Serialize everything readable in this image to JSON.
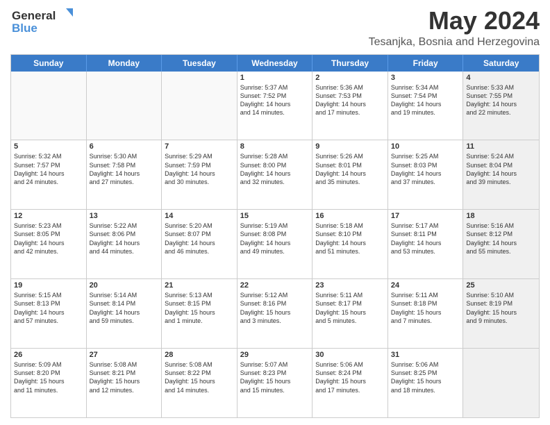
{
  "header": {
    "logo_line1": "General",
    "logo_line2": "Blue",
    "month_year": "May 2024",
    "location": "Tesanjka, Bosnia and Herzegovina"
  },
  "days_of_week": [
    "Sunday",
    "Monday",
    "Tuesday",
    "Wednesday",
    "Thursday",
    "Friday",
    "Saturday"
  ],
  "weeks": [
    [
      {
        "day": "",
        "info": "",
        "empty": true
      },
      {
        "day": "",
        "info": "",
        "empty": true
      },
      {
        "day": "",
        "info": "",
        "empty": true
      },
      {
        "day": "1",
        "info": "Sunrise: 5:37 AM\nSunset: 7:52 PM\nDaylight: 14 hours\nand 14 minutes.",
        "empty": false
      },
      {
        "day": "2",
        "info": "Sunrise: 5:36 AM\nSunset: 7:53 PM\nDaylight: 14 hours\nand 17 minutes.",
        "empty": false
      },
      {
        "day": "3",
        "info": "Sunrise: 5:34 AM\nSunset: 7:54 PM\nDaylight: 14 hours\nand 19 minutes.",
        "empty": false
      },
      {
        "day": "4",
        "info": "Sunrise: 5:33 AM\nSunset: 7:55 PM\nDaylight: 14 hours\nand 22 minutes.",
        "empty": false,
        "shaded": true
      }
    ],
    [
      {
        "day": "5",
        "info": "Sunrise: 5:32 AM\nSunset: 7:57 PM\nDaylight: 14 hours\nand 24 minutes.",
        "empty": false
      },
      {
        "day": "6",
        "info": "Sunrise: 5:30 AM\nSunset: 7:58 PM\nDaylight: 14 hours\nand 27 minutes.",
        "empty": false
      },
      {
        "day": "7",
        "info": "Sunrise: 5:29 AM\nSunset: 7:59 PM\nDaylight: 14 hours\nand 30 minutes.",
        "empty": false
      },
      {
        "day": "8",
        "info": "Sunrise: 5:28 AM\nSunset: 8:00 PM\nDaylight: 14 hours\nand 32 minutes.",
        "empty": false
      },
      {
        "day": "9",
        "info": "Sunrise: 5:26 AM\nSunset: 8:01 PM\nDaylight: 14 hours\nand 35 minutes.",
        "empty": false
      },
      {
        "day": "10",
        "info": "Sunrise: 5:25 AM\nSunset: 8:03 PM\nDaylight: 14 hours\nand 37 minutes.",
        "empty": false
      },
      {
        "day": "11",
        "info": "Sunrise: 5:24 AM\nSunset: 8:04 PM\nDaylight: 14 hours\nand 39 minutes.",
        "empty": false,
        "shaded": true
      }
    ],
    [
      {
        "day": "12",
        "info": "Sunrise: 5:23 AM\nSunset: 8:05 PM\nDaylight: 14 hours\nand 42 minutes.",
        "empty": false
      },
      {
        "day": "13",
        "info": "Sunrise: 5:22 AM\nSunset: 8:06 PM\nDaylight: 14 hours\nand 44 minutes.",
        "empty": false
      },
      {
        "day": "14",
        "info": "Sunrise: 5:20 AM\nSunset: 8:07 PM\nDaylight: 14 hours\nand 46 minutes.",
        "empty": false
      },
      {
        "day": "15",
        "info": "Sunrise: 5:19 AM\nSunset: 8:08 PM\nDaylight: 14 hours\nand 49 minutes.",
        "empty": false
      },
      {
        "day": "16",
        "info": "Sunrise: 5:18 AM\nSunset: 8:10 PM\nDaylight: 14 hours\nand 51 minutes.",
        "empty": false
      },
      {
        "day": "17",
        "info": "Sunrise: 5:17 AM\nSunset: 8:11 PM\nDaylight: 14 hours\nand 53 minutes.",
        "empty": false
      },
      {
        "day": "18",
        "info": "Sunrise: 5:16 AM\nSunset: 8:12 PM\nDaylight: 14 hours\nand 55 minutes.",
        "empty": false,
        "shaded": true
      }
    ],
    [
      {
        "day": "19",
        "info": "Sunrise: 5:15 AM\nSunset: 8:13 PM\nDaylight: 14 hours\nand 57 minutes.",
        "empty": false
      },
      {
        "day": "20",
        "info": "Sunrise: 5:14 AM\nSunset: 8:14 PM\nDaylight: 14 hours\nand 59 minutes.",
        "empty": false
      },
      {
        "day": "21",
        "info": "Sunrise: 5:13 AM\nSunset: 8:15 PM\nDaylight: 15 hours\nand 1 minute.",
        "empty": false
      },
      {
        "day": "22",
        "info": "Sunrise: 5:12 AM\nSunset: 8:16 PM\nDaylight: 15 hours\nand 3 minutes.",
        "empty": false
      },
      {
        "day": "23",
        "info": "Sunrise: 5:11 AM\nSunset: 8:17 PM\nDaylight: 15 hours\nand 5 minutes.",
        "empty": false
      },
      {
        "day": "24",
        "info": "Sunrise: 5:11 AM\nSunset: 8:18 PM\nDaylight: 15 hours\nand 7 minutes.",
        "empty": false
      },
      {
        "day": "25",
        "info": "Sunrise: 5:10 AM\nSunset: 8:19 PM\nDaylight: 15 hours\nand 9 minutes.",
        "empty": false,
        "shaded": true
      }
    ],
    [
      {
        "day": "26",
        "info": "Sunrise: 5:09 AM\nSunset: 8:20 PM\nDaylight: 15 hours\nand 11 minutes.",
        "empty": false
      },
      {
        "day": "27",
        "info": "Sunrise: 5:08 AM\nSunset: 8:21 PM\nDaylight: 15 hours\nand 12 minutes.",
        "empty": false
      },
      {
        "day": "28",
        "info": "Sunrise: 5:08 AM\nSunset: 8:22 PM\nDaylight: 15 hours\nand 14 minutes.",
        "empty": false
      },
      {
        "day": "29",
        "info": "Sunrise: 5:07 AM\nSunset: 8:23 PM\nDaylight: 15 hours\nand 15 minutes.",
        "empty": false
      },
      {
        "day": "30",
        "info": "Sunrise: 5:06 AM\nSunset: 8:24 PM\nDaylight: 15 hours\nand 17 minutes.",
        "empty": false
      },
      {
        "day": "31",
        "info": "Sunrise: 5:06 AM\nSunset: 8:25 PM\nDaylight: 15 hours\nand 18 minutes.",
        "empty": false
      },
      {
        "day": "",
        "info": "",
        "empty": true,
        "shaded": true
      }
    ]
  ]
}
